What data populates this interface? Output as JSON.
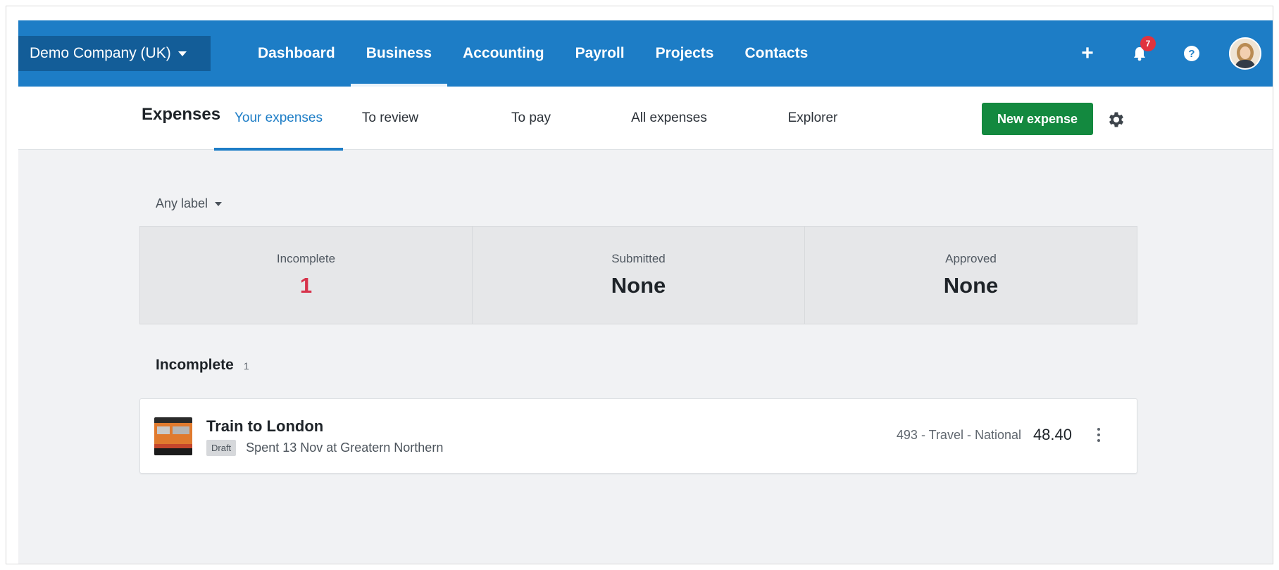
{
  "topnav": {
    "org_name": "Demo Company (UK)",
    "links": [
      {
        "label": "Dashboard"
      },
      {
        "label": "Business",
        "active": true
      },
      {
        "label": "Accounting"
      },
      {
        "label": "Payroll"
      },
      {
        "label": "Projects"
      },
      {
        "label": "Contacts"
      }
    ],
    "add_icon": "plus-icon",
    "notifications_count": "7",
    "help_icon": "help-icon",
    "avatar_icon": "user-avatar"
  },
  "subnav": {
    "title": "Expenses",
    "tabs": [
      {
        "label": "Your expenses",
        "active": true
      },
      {
        "label": "To review"
      },
      {
        "label": "To pay"
      },
      {
        "label": "All expenses"
      },
      {
        "label": "Explorer"
      }
    ],
    "new_button": "New expense",
    "settings_icon": "gear-icon"
  },
  "filter": {
    "label": "Any label"
  },
  "summary": [
    {
      "label": "Incomplete",
      "value": "1"
    },
    {
      "label": "Submitted",
      "value": "None"
    },
    {
      "label": "Approved",
      "value": "None"
    }
  ],
  "section": {
    "title": "Incomplete",
    "count": "1"
  },
  "expense": {
    "title": "Train to London",
    "status": "Draft",
    "spent": "Spent 13 Nov at Greatern Northern",
    "account": "493 - Travel - National",
    "amount": "48.40"
  },
  "colors": {
    "brand_blue": "#1d7dc6",
    "org_dark": "#135d98",
    "primary_green": "#13893f",
    "alert_red": "#d7334b",
    "badge_red": "#e0333f"
  }
}
